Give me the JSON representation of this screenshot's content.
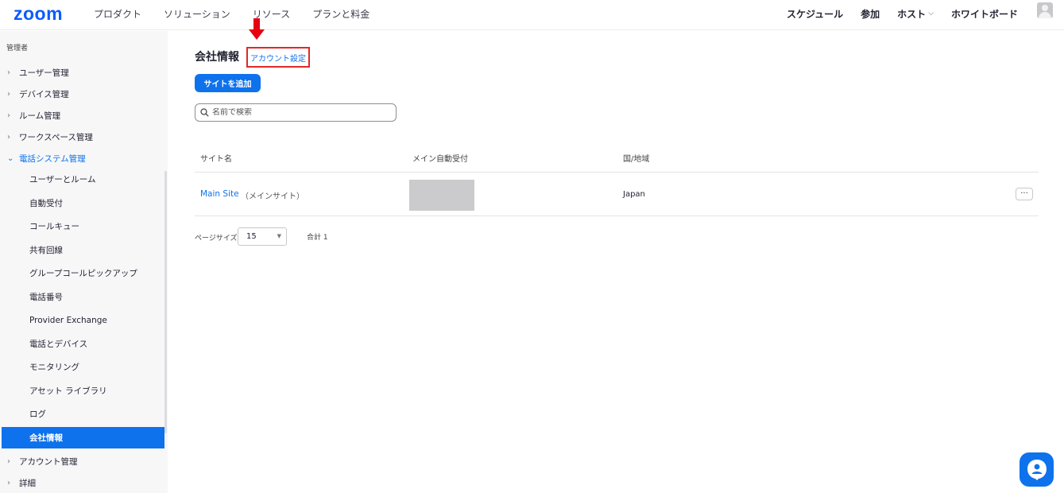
{
  "header": {
    "logo": "zoom",
    "nav_left": [
      "プロダクト",
      "ソリューション",
      "リソース",
      "プランと料金"
    ],
    "nav_right": {
      "schedule": "スケジュール",
      "join": "参加",
      "host": "ホスト",
      "whiteboard": "ホワイトボード"
    }
  },
  "sidebar": {
    "title": "管理者",
    "items_top": [
      "ユーザー管理",
      "デバイス管理",
      "ルーム管理",
      "ワークスペース管理"
    ],
    "open_section": "電話システム管理",
    "sub_items": [
      "ユーザーとルーム",
      "自動受付",
      "コールキュー",
      "共有回線",
      "グループコールピックアップ",
      "電話番号",
      "Provider Exchange",
      "電話とデバイス",
      "モニタリング",
      "アセット ライブラリ",
      "ログ",
      "会社情報"
    ],
    "active_sub": "会社情報",
    "items_bottom": [
      "アカウント管理",
      "詳細"
    ]
  },
  "main": {
    "title": "会社情報",
    "account_settings_link": "アカウント設定",
    "add_site_button": "サイトを追加",
    "search_placeholder": "名前で検索",
    "table": {
      "headers": [
        "サイト名",
        "メイン自動受付",
        "国/地域"
      ],
      "rows": [
        {
          "site_name": "Main Site",
          "site_suffix": "（メインサイト）",
          "country": "Japan",
          "more": "···"
        }
      ]
    },
    "pagination": {
      "page_size_label": "ページサイズ",
      "page_size_value": "15",
      "total_label": "合計 1"
    }
  },
  "colors": {
    "accent": "#0e72ed",
    "logo": "#0b5cff",
    "highlight_border": "#e02828",
    "arrow": "#e60012"
  },
  "icons": {
    "search": "search-icon",
    "chat": "chat-bot-icon",
    "avatar": "user-avatar-icon",
    "arrow": "red-down-arrow-icon"
  }
}
